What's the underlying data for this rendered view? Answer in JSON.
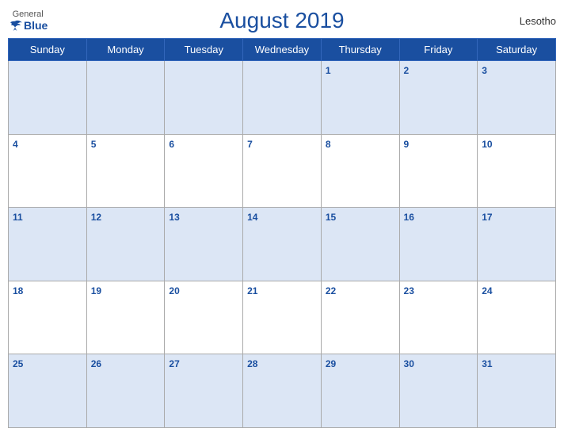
{
  "header": {
    "title": "August 2019",
    "country": "Lesotho",
    "logo": {
      "general": "General",
      "blue": "Blue"
    }
  },
  "weekdays": [
    "Sunday",
    "Monday",
    "Tuesday",
    "Wednesday",
    "Thursday",
    "Friday",
    "Saturday"
  ],
  "weeks": [
    [
      null,
      null,
      null,
      null,
      1,
      2,
      3
    ],
    [
      4,
      5,
      6,
      7,
      8,
      9,
      10
    ],
    [
      11,
      12,
      13,
      14,
      15,
      16,
      17
    ],
    [
      18,
      19,
      20,
      21,
      22,
      23,
      24
    ],
    [
      25,
      26,
      27,
      28,
      29,
      30,
      31
    ]
  ]
}
